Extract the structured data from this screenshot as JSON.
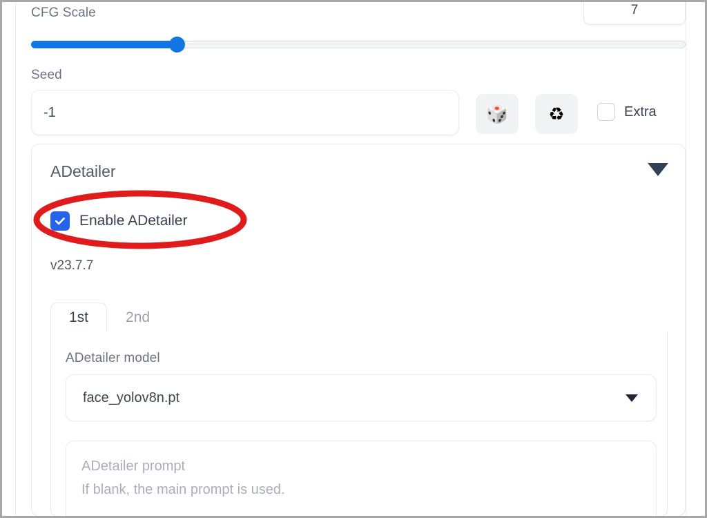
{
  "cfg": {
    "label": "CFG Scale",
    "value": "7",
    "slider_fill_percent": 22
  },
  "seed": {
    "label": "Seed",
    "value": "-1",
    "dice_button_icon": "dice-icon",
    "dice_button_glyph": "🎲",
    "recycle_button_icon": "recycle-icon",
    "recycle_button_glyph": "♻",
    "extra_label": "Extra",
    "extra_checked": false
  },
  "adetailer": {
    "title": "ADetailer",
    "collapse_icon": "chevron-down-icon",
    "enable_label": "Enable ADetailer",
    "enable_checked": true,
    "version": "v23.7.7",
    "tabs": [
      {
        "label": "1st",
        "active": true
      },
      {
        "label": "2nd",
        "active": false
      }
    ],
    "model": {
      "label": "ADetailer model",
      "value": "face_yolov8n.pt",
      "caret_icon": "caret-down-icon"
    },
    "prompt": {
      "value": "",
      "placeholder": "ADetailer prompt\nIf blank, the main prompt is used."
    }
  },
  "annotation": {
    "shape": "ellipse",
    "color": "#e01b1b",
    "target": "enable-adetailer-checkbox"
  },
  "colors": {
    "accent_blue": "#1275e4",
    "checkbox_blue": "#2563eb",
    "annotation_red": "#e01b1b",
    "label_gray": "#6b7280",
    "border_gray": "#e5e7eb"
  }
}
